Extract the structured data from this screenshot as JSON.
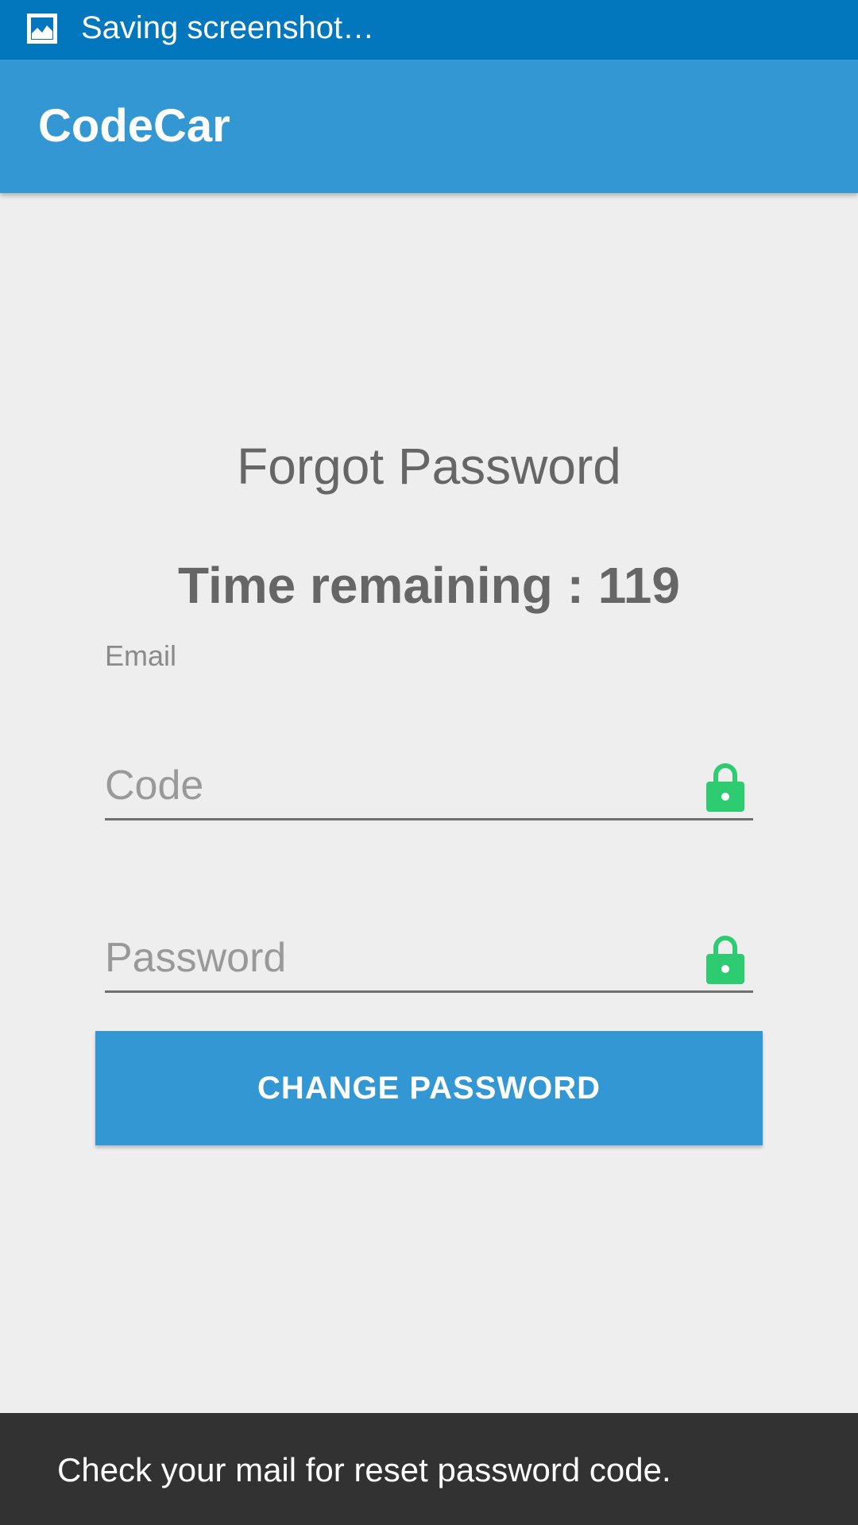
{
  "status_bar": {
    "icon": "image-icon",
    "text": "Saving screenshot…"
  },
  "app_bar": {
    "title": "CodeCar",
    "color": "#3297d3"
  },
  "main": {
    "heading": "Forgot Password",
    "timer_label": "Time remaining : ",
    "timer_value": "119",
    "email_label": "Email",
    "code_field": {
      "value": "",
      "placeholder": "Code",
      "icon": "lock-icon"
    },
    "password_field": {
      "value": "",
      "placeholder": "Password",
      "icon": "lock-icon"
    },
    "submit_label": "CHANGE PASSWORD",
    "icon_color": "#2ecc71"
  },
  "snackbar": {
    "message": "Check your mail for reset password code."
  }
}
